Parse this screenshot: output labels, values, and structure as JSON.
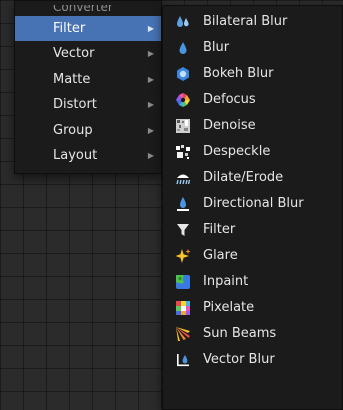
{
  "category_menu": {
    "clipped_label": "Converter",
    "items": [
      {
        "label": "Filter",
        "active": true
      },
      {
        "label": "Vector"
      },
      {
        "label": "Matte"
      },
      {
        "label": "Distort"
      },
      {
        "label": "Group"
      },
      {
        "label": "Layout"
      }
    ],
    "submenu_arrow": "▶"
  },
  "filter_submenu": {
    "items": [
      {
        "label": "Bilateral Blur",
        "icon": "bilateral-blur-icon"
      },
      {
        "label": "Blur",
        "icon": "blur-icon"
      },
      {
        "label": "Bokeh Blur",
        "icon": "bokeh-blur-icon"
      },
      {
        "label": "Defocus",
        "icon": "defocus-icon"
      },
      {
        "label": "Denoise",
        "icon": "denoise-icon"
      },
      {
        "label": "Despeckle",
        "icon": "despeckle-icon"
      },
      {
        "label": "Dilate/Erode",
        "icon": "dilate-erode-icon"
      },
      {
        "label": "Directional Blur",
        "icon": "directional-blur-icon"
      },
      {
        "label": "Filter",
        "icon": "filter-icon"
      },
      {
        "label": "Glare",
        "icon": "glare-icon"
      },
      {
        "label": "Inpaint",
        "icon": "inpaint-icon"
      },
      {
        "label": "Pixelate",
        "icon": "pixelate-icon"
      },
      {
        "label": "Sun Beams",
        "icon": "sun-beams-icon"
      },
      {
        "label": "Vector Blur",
        "icon": "vector-blur-icon"
      }
    ]
  },
  "colors": {
    "menu_bg": "#1b1b1b",
    "highlight": "#4772b3",
    "grid_bg": "#2b2b2b",
    "text": "#e6e6e6"
  }
}
